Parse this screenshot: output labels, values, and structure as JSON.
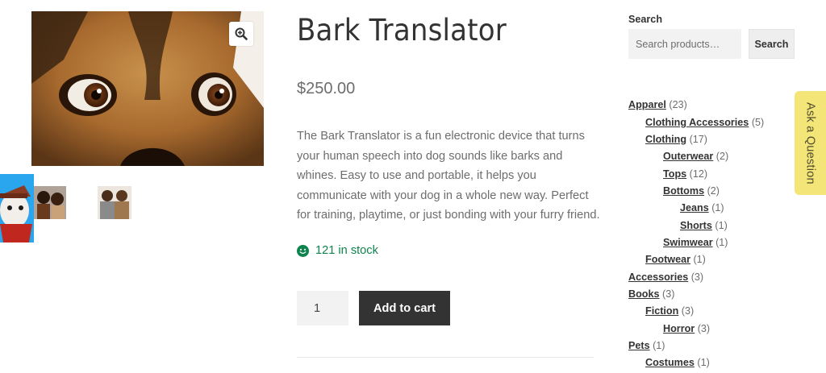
{
  "product": {
    "title": "Bark Translator",
    "price": "$250.00",
    "description": "The Bark Translator is a fun electronic device that turns your human speech into dog sounds like barks and whines. Easy to use and portable, it helps you communicate with your dog in a whole new way. Perfect for training, playtime, or just bonding with your furry friend.",
    "stock": "121 in stock",
    "quantity": "1",
    "add_to_cart_label": "Add to cart"
  },
  "gallery": {
    "zoom_icon": "magnifier-plus-icon"
  },
  "sidebar": {
    "search_heading": "Search",
    "search_placeholder": "Search products…",
    "search_button": "Search",
    "categories": [
      {
        "name": "Apparel",
        "count": "(23)"
      },
      {
        "name": "Clothing Accessories",
        "count": "(5)"
      },
      {
        "name": "Clothing",
        "count": "(17)"
      },
      {
        "name": "Outerwear",
        "count": "(2)"
      },
      {
        "name": "Tops",
        "count": "(12)"
      },
      {
        "name": "Bottoms",
        "count": "(2)"
      },
      {
        "name": "Jeans",
        "count": "(1)"
      },
      {
        "name": "Shorts",
        "count": "(1)"
      },
      {
        "name": "Swimwear",
        "count": "(1)"
      },
      {
        "name": "Footwear",
        "count": "(1)"
      },
      {
        "name": "Accessories",
        "count": "(3)"
      },
      {
        "name": "Books",
        "count": "(3)"
      },
      {
        "name": "Fiction",
        "count": "(3)"
      },
      {
        "name": "Horror",
        "count": "(3)"
      },
      {
        "name": "Pets",
        "count": "(1)"
      },
      {
        "name": "Costumes",
        "count": "(1)"
      }
    ]
  },
  "ask_question": "Ask a Question",
  "colors": {
    "stock_green": "#0f834d",
    "button_dark": "#333333",
    "ask_tab": "#f3e577",
    "thumb_blue": "#2aa6ee"
  }
}
